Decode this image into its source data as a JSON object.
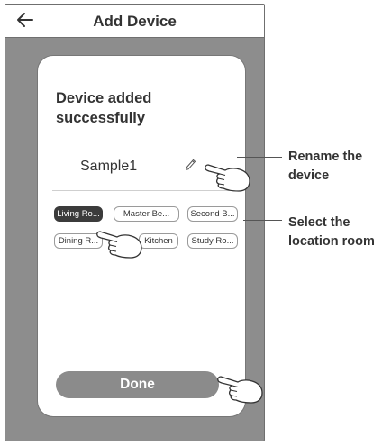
{
  "header": {
    "title": "Add Device",
    "back_icon": "arrow-left-icon"
  },
  "card": {
    "heading": "Device added successfully",
    "device_name": "Sample1",
    "edit_icon": "pencil-icon"
  },
  "rooms": [
    {
      "label": "Living Ro...",
      "selected": true
    },
    {
      "label": "Master Be...",
      "selected": false
    },
    {
      "label": "Second B...",
      "selected": false
    },
    {
      "label": "Dining R...",
      "selected": false
    },
    {
      "label": "Kitchen",
      "selected": false
    },
    {
      "label": "Study Ro...",
      "selected": false
    }
  ],
  "done_label": "Done",
  "callouts": {
    "rename": "Rename the device",
    "location": "Select the location room"
  },
  "colors": {
    "overlay": "#8d8d8d",
    "selected_chip": "#3b3b3b",
    "done_button": "#8b8b8b"
  }
}
